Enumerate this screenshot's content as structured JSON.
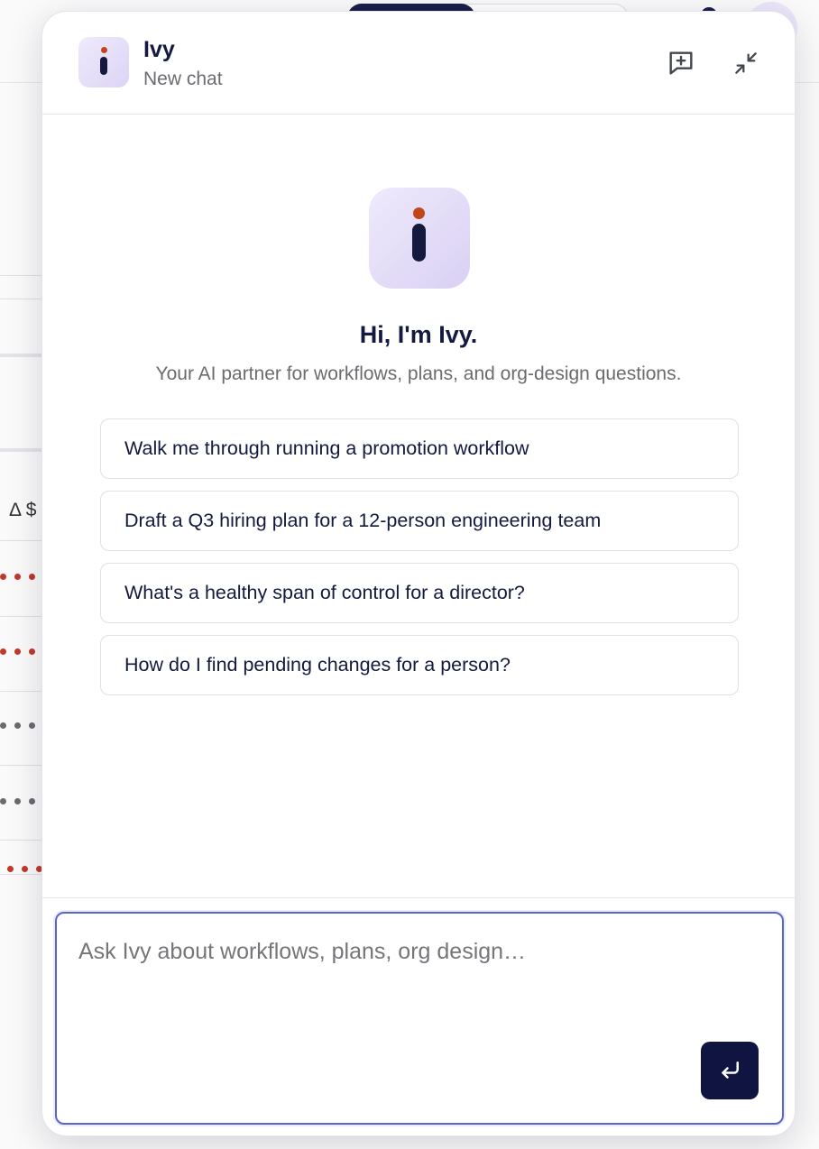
{
  "background": {
    "delta_label": "Δ $",
    "row_menus": [
      {
        "color": "red"
      },
      {
        "color": "red"
      },
      {
        "color": "grey"
      },
      {
        "color": "grey"
      },
      {
        "color": "red"
      }
    ]
  },
  "chat": {
    "header": {
      "title": "Ivy",
      "subtitle": "New chat",
      "new_chat_icon": "message-plus-icon",
      "minimize_icon": "collapse-arrows-icon"
    },
    "welcome": {
      "title": "Hi, I'm Ivy.",
      "subtitle": "Your AI partner for workflows, plans, and org-design questions."
    },
    "suggestions": [
      "Walk me through running a promotion workflow",
      "Draft a Q3 hiring plan for a 12-person engineering team",
      "What's a healthy span of control for a director?",
      "How do I find pending changes for a person?"
    ],
    "composer": {
      "placeholder": "Ask Ivy about workflows, plans, org design…",
      "value": "",
      "send_icon": "enter-return-icon"
    }
  },
  "colors": {
    "brand_navy": "#13193f",
    "brand_accent": "#c2461c",
    "logo_bg": "#e6e0f8",
    "focus_border": "#5865c9"
  }
}
